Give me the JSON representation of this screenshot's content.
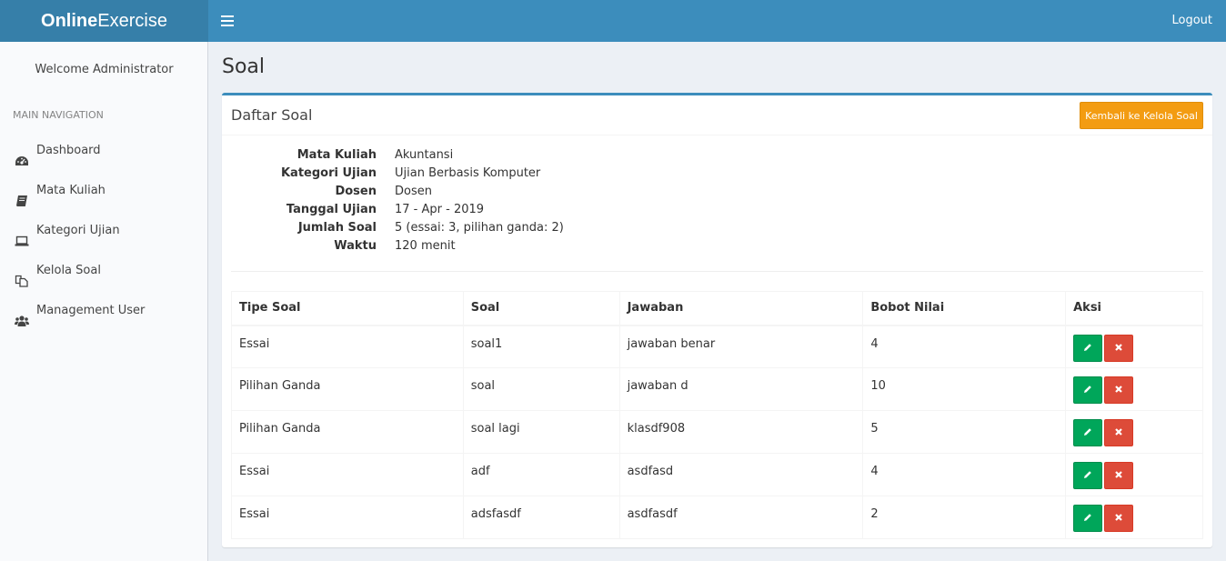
{
  "header": {
    "logo_bold": "Online",
    "logo_rest": "Exercise",
    "logout": "Logout"
  },
  "sidebar": {
    "welcome": "Welcome Administrator",
    "nav_header": "MAIN NAVIGATION",
    "items": [
      {
        "label": "Dashboard",
        "icon": "dashboard-icon"
      },
      {
        "label": "Mata Kuliah",
        "icon": "book-icon"
      },
      {
        "label": "Kategori Ujian",
        "icon": "laptop-icon"
      },
      {
        "label": "Kelola Soal",
        "icon": "copy-icon"
      },
      {
        "label": "Management User",
        "icon": "users-icon"
      }
    ]
  },
  "page": {
    "title": "Soal",
    "box_title": "Daftar Soal",
    "back_button": "Kembali ke Kelola Soal"
  },
  "info": [
    {
      "label": "Mata Kuliah",
      "value": "Akuntansi"
    },
    {
      "label": "Kategori Ujian",
      "value": "Ujian Berbasis Komputer"
    },
    {
      "label": "Dosen",
      "value": "Dosen"
    },
    {
      "label": "Tanggal Ujian",
      "value": "17 - Apr - 2019"
    },
    {
      "label": "Jumlah Soal",
      "value": "5 (essai: 3, pilihan ganda: 2)"
    },
    {
      "label": "Waktu",
      "value": "120 menit"
    }
  ],
  "table": {
    "headers": [
      "Tipe Soal",
      "Soal",
      "Jawaban",
      "Bobot Nilai",
      "Aksi"
    ],
    "rows": [
      [
        "Essai",
        "soal1",
        "jawaban benar",
        "4"
      ],
      [
        "Pilihan Ganda",
        "soal",
        "jawaban d",
        "10"
      ],
      [
        "Pilihan Ganda",
        "soal lagi",
        "klasdf908",
        "5"
      ],
      [
        "Essai",
        "adf",
        "asdfasd",
        "4"
      ],
      [
        "Essai",
        "adsfasdf",
        "asdfasdf",
        "2"
      ]
    ]
  },
  "colors": {
    "header": "#3c8dbc",
    "logo_bg": "#367fa9",
    "warning": "#f39c12",
    "success": "#00a65a",
    "danger": "#dd4b39"
  }
}
